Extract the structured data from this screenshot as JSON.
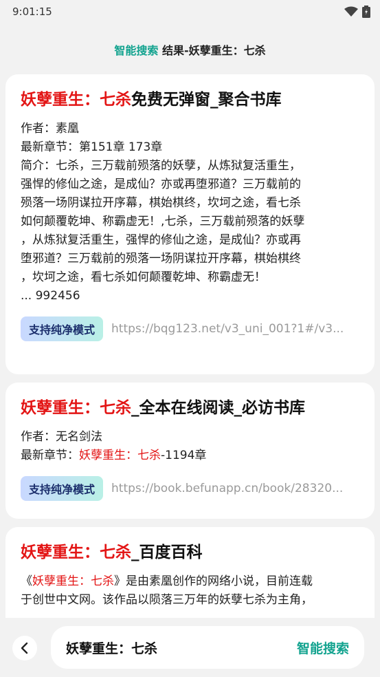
{
  "status_bar": {
    "time": "9:01:15"
  },
  "header": {
    "accent": "智能搜索",
    "rest": " 结果-妖孽重生：七杀"
  },
  "results": [
    {
      "title_highlight": "妖孽重生：七杀",
      "title_rest": "免费无弹窗_聚合书库",
      "author": "作者：素凰",
      "latest": "最新章节：第151章 173章",
      "intro_lines": [
        "简介：七杀，三万载前殒落的妖孽，从炼狱复活重生，",
        "强悍的修仙之途，是成仙？亦或再堕邪道？三万载前的",
        "殒落一场阴谋拉开序幕，棋始棋终，坎坷之途，看七杀",
        "如何颠覆乾坤、称霸虚无！,七杀，三万载前殒落的妖孽",
        "，从炼狱复活重生，强悍的修仙之途，是成仙？亦或再",
        "堕邪道？三万载前的殒落一场阴谋拉开序幕，棋始棋终",
        "，坎坷之途，看七杀如何颠覆乾坤、称霸虚无！",
        "... 992456"
      ],
      "badge": "支持纯净模式",
      "url": "https://bqg123.net/v3_uni_001?1#/v3..."
    },
    {
      "title_highlight": "妖孽重生：七杀",
      "title_rest": "_全本在线阅读_必访书库",
      "author": "作者：无名剑法",
      "latest_prefix": "最新章节：",
      "latest_highlight": "妖孽重生：七杀",
      "latest_suffix": "-1194章",
      "badge": "支持纯净模式",
      "url": "https://book.befunapp.cn/book/28320..."
    },
    {
      "title_highlight": "妖孽重生：七杀",
      "title_rest": "_百度百科",
      "desc_open": "《",
      "desc_highlight": "妖孽重生：七杀",
      "desc_rest1": "》是由素凰创作的网络小说，目前连载",
      "desc_line2": "于创世中文网。该作品以陨落三万年的妖孽七杀为主角，"
    }
  ],
  "bottom_bar": {
    "query": "妖孽重生：七杀",
    "action": "智能搜索"
  },
  "colors": {
    "accent": "#13a38f",
    "highlight": "#e31515"
  },
  "icons": {
    "back": "chevron-left-icon",
    "wifi": "wifi-icon",
    "battery": "battery-icon"
  }
}
